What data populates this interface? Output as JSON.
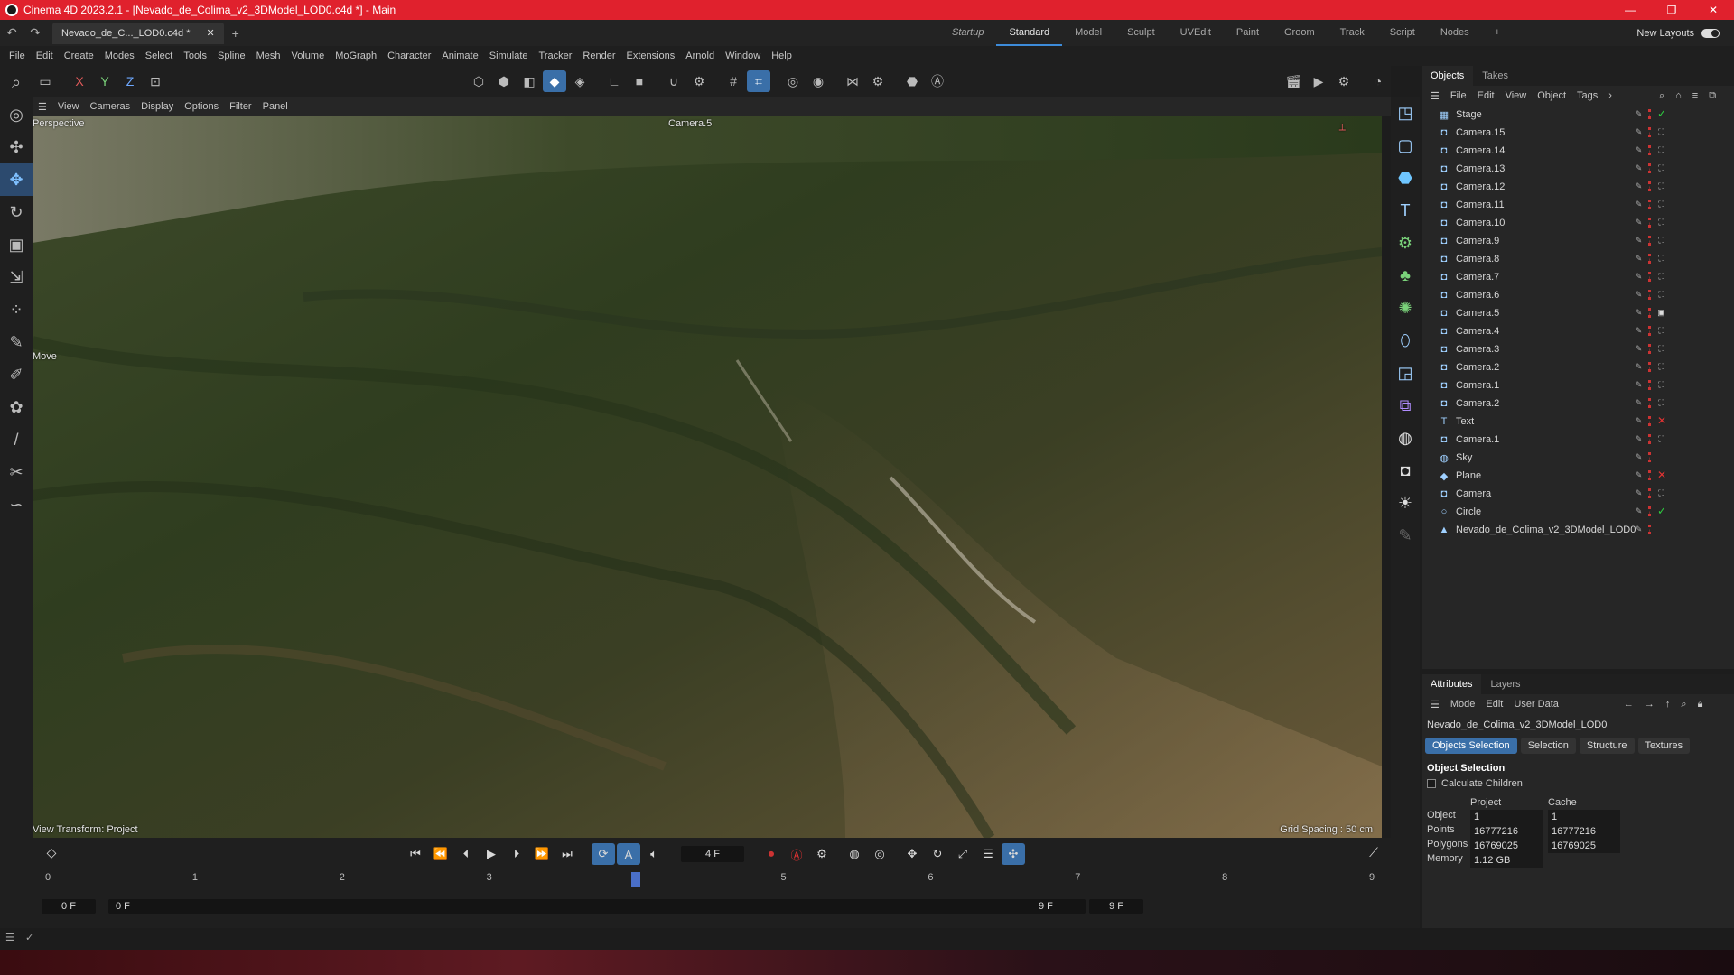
{
  "window": {
    "title": "Cinema 4D 2023.2.1 - [Nevado_de_Colima_v2_3DModel_LOD0.c4d *] - Main",
    "controls": [
      "—",
      "❐",
      "✕"
    ]
  },
  "tabbar": {
    "doc_tab": "Nevado_de_C..._LOD0.c4d *",
    "close": "✕",
    "add": "+",
    "layouts": [
      {
        "label": "Startup",
        "style": "italic"
      },
      {
        "label": "Standard",
        "style": "active"
      },
      {
        "label": "Model",
        "style": ""
      },
      {
        "label": "Sculpt",
        "style": ""
      },
      {
        "label": "UVEdit",
        "style": ""
      },
      {
        "label": "Paint",
        "style": ""
      },
      {
        "label": "Groom",
        "style": ""
      },
      {
        "label": "Track",
        "style": ""
      },
      {
        "label": "Script",
        "style": ""
      },
      {
        "label": "Nodes",
        "style": ""
      }
    ],
    "plus": "+",
    "new_layouts": "New Layouts"
  },
  "menubar": [
    "File",
    "Edit",
    "Create",
    "Modes",
    "Select",
    "Tools",
    "Spline",
    "Mesh",
    "Volume",
    "MoGraph",
    "Character",
    "Animate",
    "Simulate",
    "Tracker",
    "Render",
    "Extensions",
    "Arnold",
    "Window",
    "Help"
  ],
  "axis_lock": {
    "x": "X",
    "y": "Y",
    "z": "Z"
  },
  "viewport": {
    "menu": [
      "View",
      "Cameras",
      "Display",
      "Options",
      "Filter",
      "Panel"
    ],
    "projection": "Perspective",
    "camera": "Camera.5",
    "tool": "Move",
    "view_transform": "View Transform: Project",
    "grid_spacing": "Grid Spacing : 50 cm"
  },
  "timeline": {
    "current_frame": "4 F",
    "ruler": [
      "0",
      "1",
      "2",
      "3",
      "4",
      "5",
      "6",
      "7",
      "8",
      "9"
    ],
    "start": "0 F",
    "range_start": "0 F",
    "range_end": "9 F",
    "end": "9 F",
    "playhead_frame": 4,
    "total_frames": 9
  },
  "objects_panel": {
    "tabs": [
      "Objects",
      "Takes"
    ],
    "menu": [
      "File",
      "Edit",
      "View",
      "Object",
      "Tags"
    ],
    "items": [
      {
        "name": "Stage",
        "icon": "stage-icon",
        "glyph": "▦",
        "status": "check"
      },
      {
        "name": "Camera.15",
        "icon": "camera-icon",
        "glyph": "◘",
        "status": "frame"
      },
      {
        "name": "Camera.14",
        "icon": "camera-icon",
        "glyph": "◘",
        "status": "frame"
      },
      {
        "name": "Camera.13",
        "icon": "camera-icon",
        "glyph": "◘",
        "status": "frame"
      },
      {
        "name": "Camera.12",
        "icon": "camera-icon",
        "glyph": "◘",
        "status": "frame"
      },
      {
        "name": "Camera.11",
        "icon": "camera-icon",
        "glyph": "◘",
        "status": "frame"
      },
      {
        "name": "Camera.10",
        "icon": "camera-icon",
        "glyph": "◘",
        "status": "frame"
      },
      {
        "name": "Camera.9",
        "icon": "camera-icon",
        "glyph": "◘",
        "status": "frame"
      },
      {
        "name": "Camera.8",
        "icon": "camera-icon",
        "glyph": "◘",
        "status": "frame"
      },
      {
        "name": "Camera.7",
        "icon": "camera-icon",
        "glyph": "◘",
        "status": "frame"
      },
      {
        "name": "Camera.6",
        "icon": "camera-icon",
        "glyph": "◘",
        "status": "frame"
      },
      {
        "name": "Camera.5",
        "icon": "camera-icon",
        "glyph": "◘",
        "status": "active"
      },
      {
        "name": "Camera.4",
        "icon": "camera-icon",
        "glyph": "◘",
        "status": "frame"
      },
      {
        "name": "Camera.3",
        "icon": "camera-icon",
        "glyph": "◘",
        "status": "frame"
      },
      {
        "name": "Camera.2",
        "icon": "camera-icon",
        "glyph": "◘",
        "status": "frame"
      },
      {
        "name": "Camera.1",
        "icon": "camera-icon",
        "glyph": "◘",
        "status": "frame"
      },
      {
        "name": "Camera.2",
        "icon": "camera-icon",
        "glyph": "◘",
        "status": "frame"
      },
      {
        "name": "Text",
        "icon": "text-icon",
        "glyph": "T",
        "status": "cross"
      },
      {
        "name": "Camera.1",
        "icon": "camera-icon",
        "glyph": "◘",
        "status": "frame"
      },
      {
        "name": "Sky",
        "icon": "sky-icon",
        "glyph": "◍",
        "status": "none"
      },
      {
        "name": "Plane",
        "icon": "plane-icon",
        "glyph": "◆",
        "status": "cross"
      },
      {
        "name": "Camera",
        "icon": "camera-icon",
        "glyph": "◘",
        "status": "frame"
      },
      {
        "name": "Circle",
        "icon": "circle-icon",
        "glyph": "○",
        "status": "check"
      },
      {
        "name": "Nevado_de_Colima_v2_3DModel_LOD0",
        "icon": "mesh-icon",
        "glyph": "▲",
        "status": "none"
      }
    ]
  },
  "attributes_panel": {
    "tabs": [
      "Attributes",
      "Layers"
    ],
    "menu": [
      "Mode",
      "Edit",
      "User Data"
    ],
    "object_name": "Nevado_de_Colima_v2_3DModel_LOD0",
    "subtabs": [
      "Objects Selection",
      "Selection",
      "Structure",
      "Textures"
    ],
    "section": "Object Selection",
    "checkbox": "Calculate Children",
    "columns": [
      "Project",
      "Cache"
    ],
    "rows": [
      {
        "label": "Object",
        "project": "1",
        "cache": "1"
      },
      {
        "label": "Points",
        "project": "16777216",
        "cache": "16777216"
      },
      {
        "label": "Polygons",
        "project": "16769025",
        "cache": "16769025"
      },
      {
        "label": "Memory",
        "project": "1.12 GB",
        "cache": ""
      }
    ]
  },
  "colors": {
    "titlebar": "#e0212d",
    "accent": "#3a6fa8",
    "check": "#2ecc40",
    "cross": "#e33333"
  }
}
